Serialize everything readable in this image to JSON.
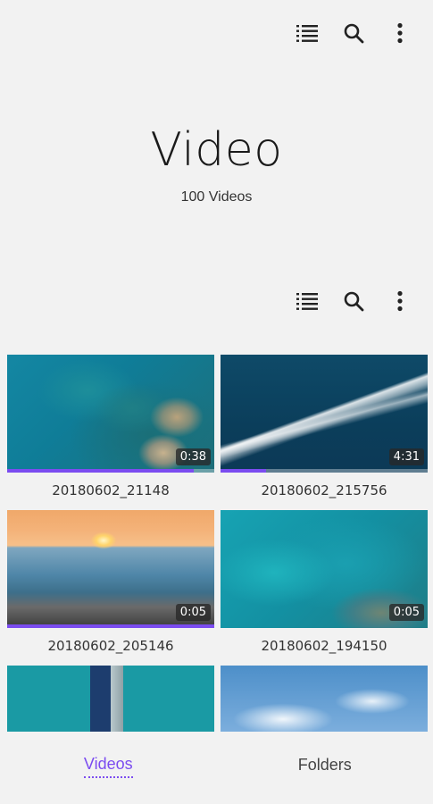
{
  "header": {
    "title": "Video",
    "subtitle": "100 Videos"
  },
  "toolbar_icons": [
    "list-icon",
    "search-icon",
    "more-vert-icon"
  ],
  "videos": [
    {
      "name": "20180602_21148",
      "duration": "0:38",
      "progress": 0.9
    },
    {
      "name": "20180602_215756",
      "duration": "4:31",
      "progress": 0.22
    },
    {
      "name": "20180602_205146",
      "duration": "0:05",
      "progress": 1.0
    },
    {
      "name": "20180602_194150",
      "duration": "0:05",
      "progress": 0
    },
    {
      "name": "",
      "duration": "",
      "progress": 0
    },
    {
      "name": "",
      "duration": "",
      "progress": 0
    }
  ],
  "bottom_nav": {
    "videos_label": "Videos",
    "folders_label": "Folders",
    "active": "Videos"
  },
  "colors": {
    "accent": "#7b4cf0",
    "background": "#f2f2f2"
  }
}
